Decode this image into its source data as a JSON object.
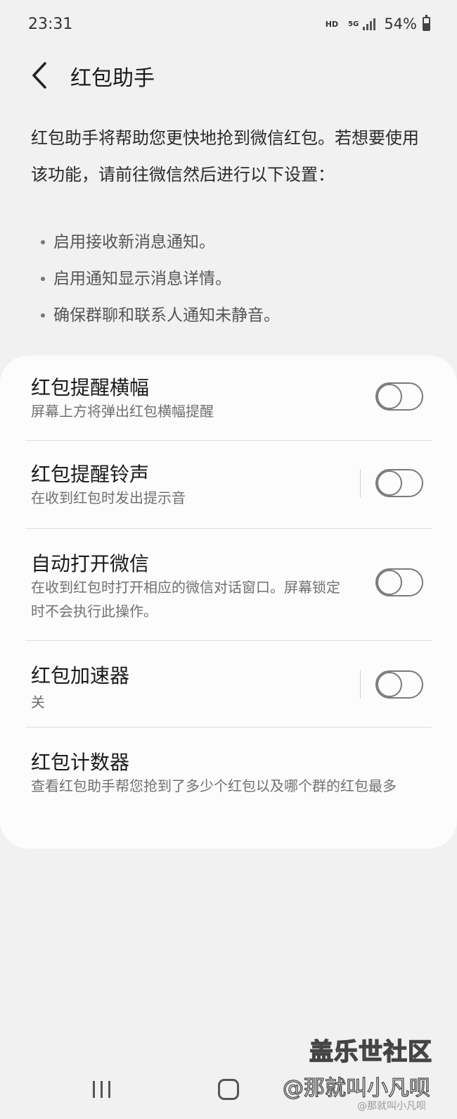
{
  "status_bar": {
    "time": "23:31",
    "hd": "HD",
    "network": "5G",
    "battery": "54%"
  },
  "header": {
    "title": "红包助手"
  },
  "description": {
    "text": "红包助手将帮助您更快地抢到微信红包。若想要使用该功能，请前往微信然后进行以下设置：",
    "bullets": [
      "启用接收新消息通知。",
      "启用通知显示消息详情。",
      "确保群聊和联系人通知未静音。"
    ]
  },
  "settings": [
    {
      "title": "红包提醒横幅",
      "subtitle": "屏幕上方将弹出红包横幅提醒",
      "toggle": "off"
    },
    {
      "title": "红包提醒铃声",
      "subtitle": "在收到红包时发出提示音",
      "toggle": "off"
    },
    {
      "title": "自动打开微信",
      "subtitle": "在收到红包时打开相应的微信对话窗口。屏幕锁定时不会执行此操作。",
      "toggle": "off"
    },
    {
      "title": "红包加速器",
      "subtitle": "关",
      "toggle": "off"
    },
    {
      "title": "红包计数器",
      "subtitle": "查看红包助手帮您抢到了多少个红包以及哪个群的红包最多"
    }
  ],
  "watermark": {
    "line1": "盖乐世社区",
    "line2": "@那就叫小凡呗",
    "line3": "@那就叫小凡呗"
  },
  "icons": {
    "back": "back-arrow-icon",
    "recents": "recents-icon",
    "home": "home-icon"
  },
  "colors": {
    "background": "#f1f1f1",
    "card": "#fcfcfc",
    "toggle_outline": "#7a7a7a"
  }
}
